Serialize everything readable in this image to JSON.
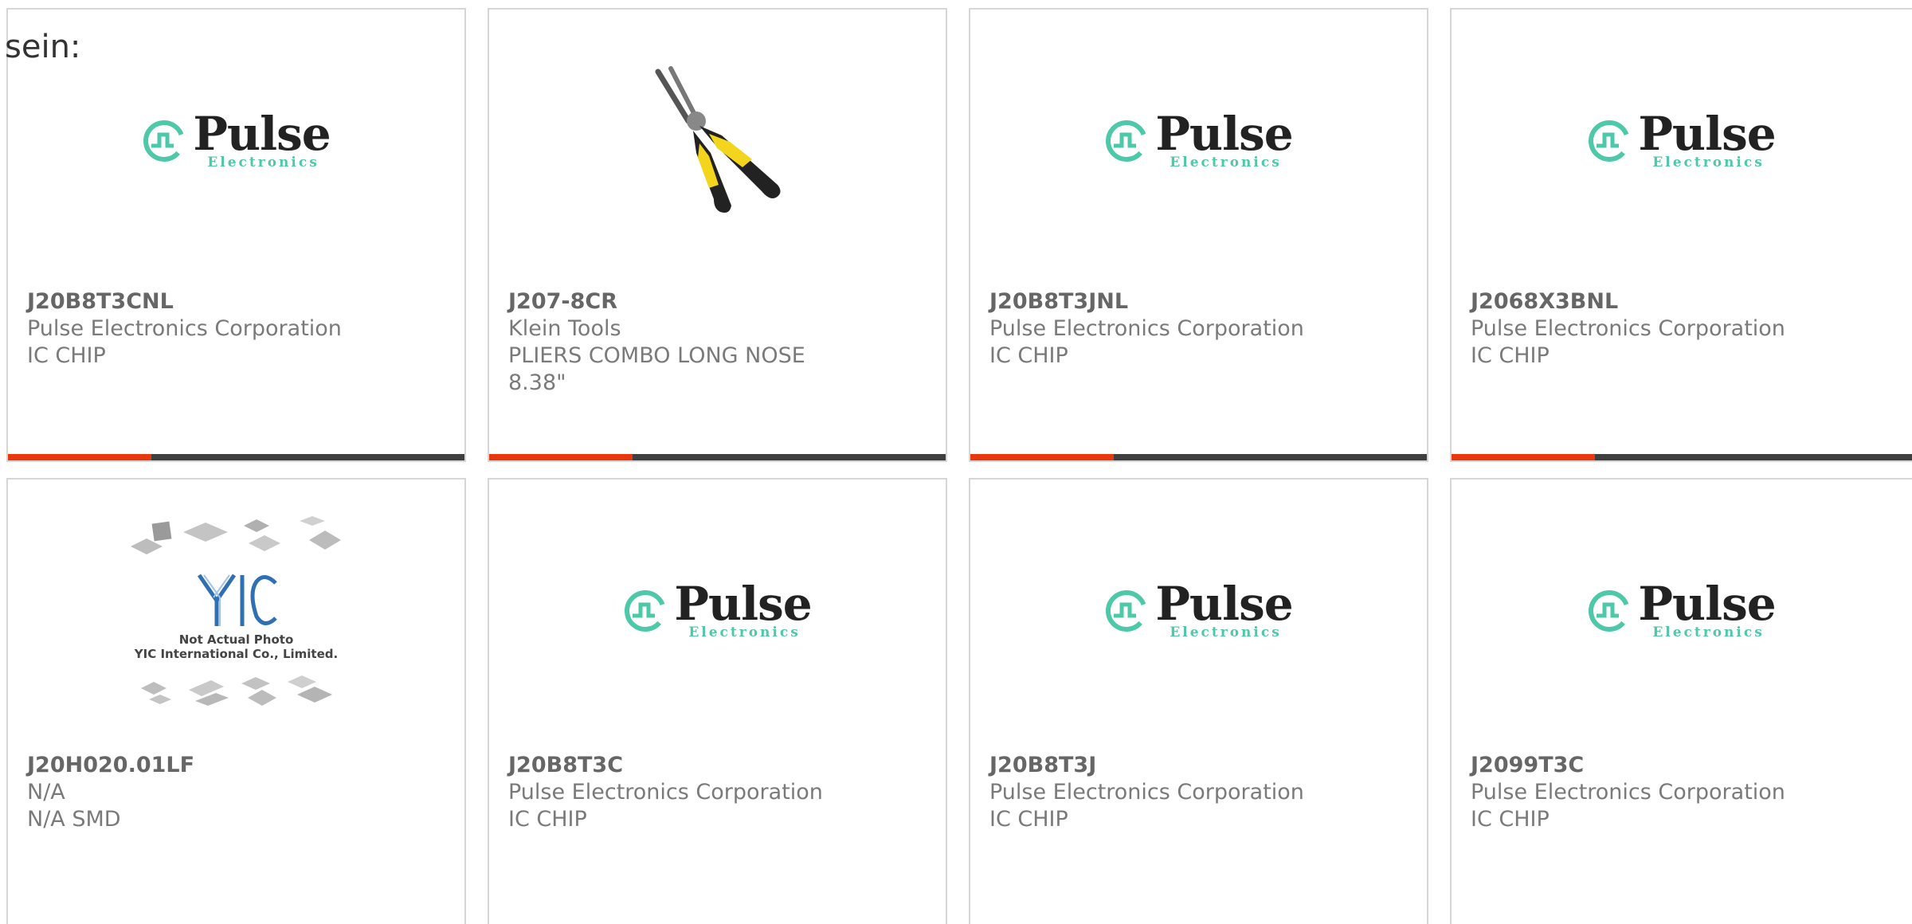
{
  "lead_text": "sein:",
  "colors": {
    "accent": "#e8380d",
    "bar": "#3f3f3f",
    "pulse_teal": "#4dc9aa",
    "border": "#d6d6d6"
  },
  "pulse_logo": {
    "name": "Pulse",
    "sub": "Electronics"
  },
  "yic_logo": {
    "caption_1": "Not Actual Photo",
    "caption_2": "YIC International Co., Limited."
  },
  "products": [
    {
      "part": "J20B8T3CNL",
      "maker": "Pulse Electronics Corporation",
      "desc": "IC CHIP",
      "image": "pulse-logo"
    },
    {
      "part": "J207-8CR",
      "maker": "Klein Tools",
      "desc": "PLIERS COMBO LONG NOSE",
      "desc2": "8.38\"",
      "image": "pliers-photo"
    },
    {
      "part": "J20B8T3JNL",
      "maker": "Pulse Electronics Corporation",
      "desc": "IC CHIP",
      "image": "pulse-logo"
    },
    {
      "part": "J2068X3BNL",
      "maker": "Pulse Electronics Corporation",
      "desc": "IC CHIP",
      "image": "pulse-logo"
    },
    {
      "part": "J20H020.01LF",
      "maker": "N/A",
      "desc": "N/A SMD",
      "image": "yic-placeholder"
    },
    {
      "part": "J20B8T3C",
      "maker": "Pulse Electronics Corporation",
      "desc": "IC CHIP",
      "image": "pulse-logo"
    },
    {
      "part": "J20B8T3J",
      "maker": "Pulse Electronics Corporation",
      "desc": "IC CHIP",
      "image": "pulse-logo"
    },
    {
      "part": "J2099T3C",
      "maker": "Pulse Electronics Corporation",
      "desc": "IC CHIP",
      "image": "pulse-logo"
    }
  ]
}
